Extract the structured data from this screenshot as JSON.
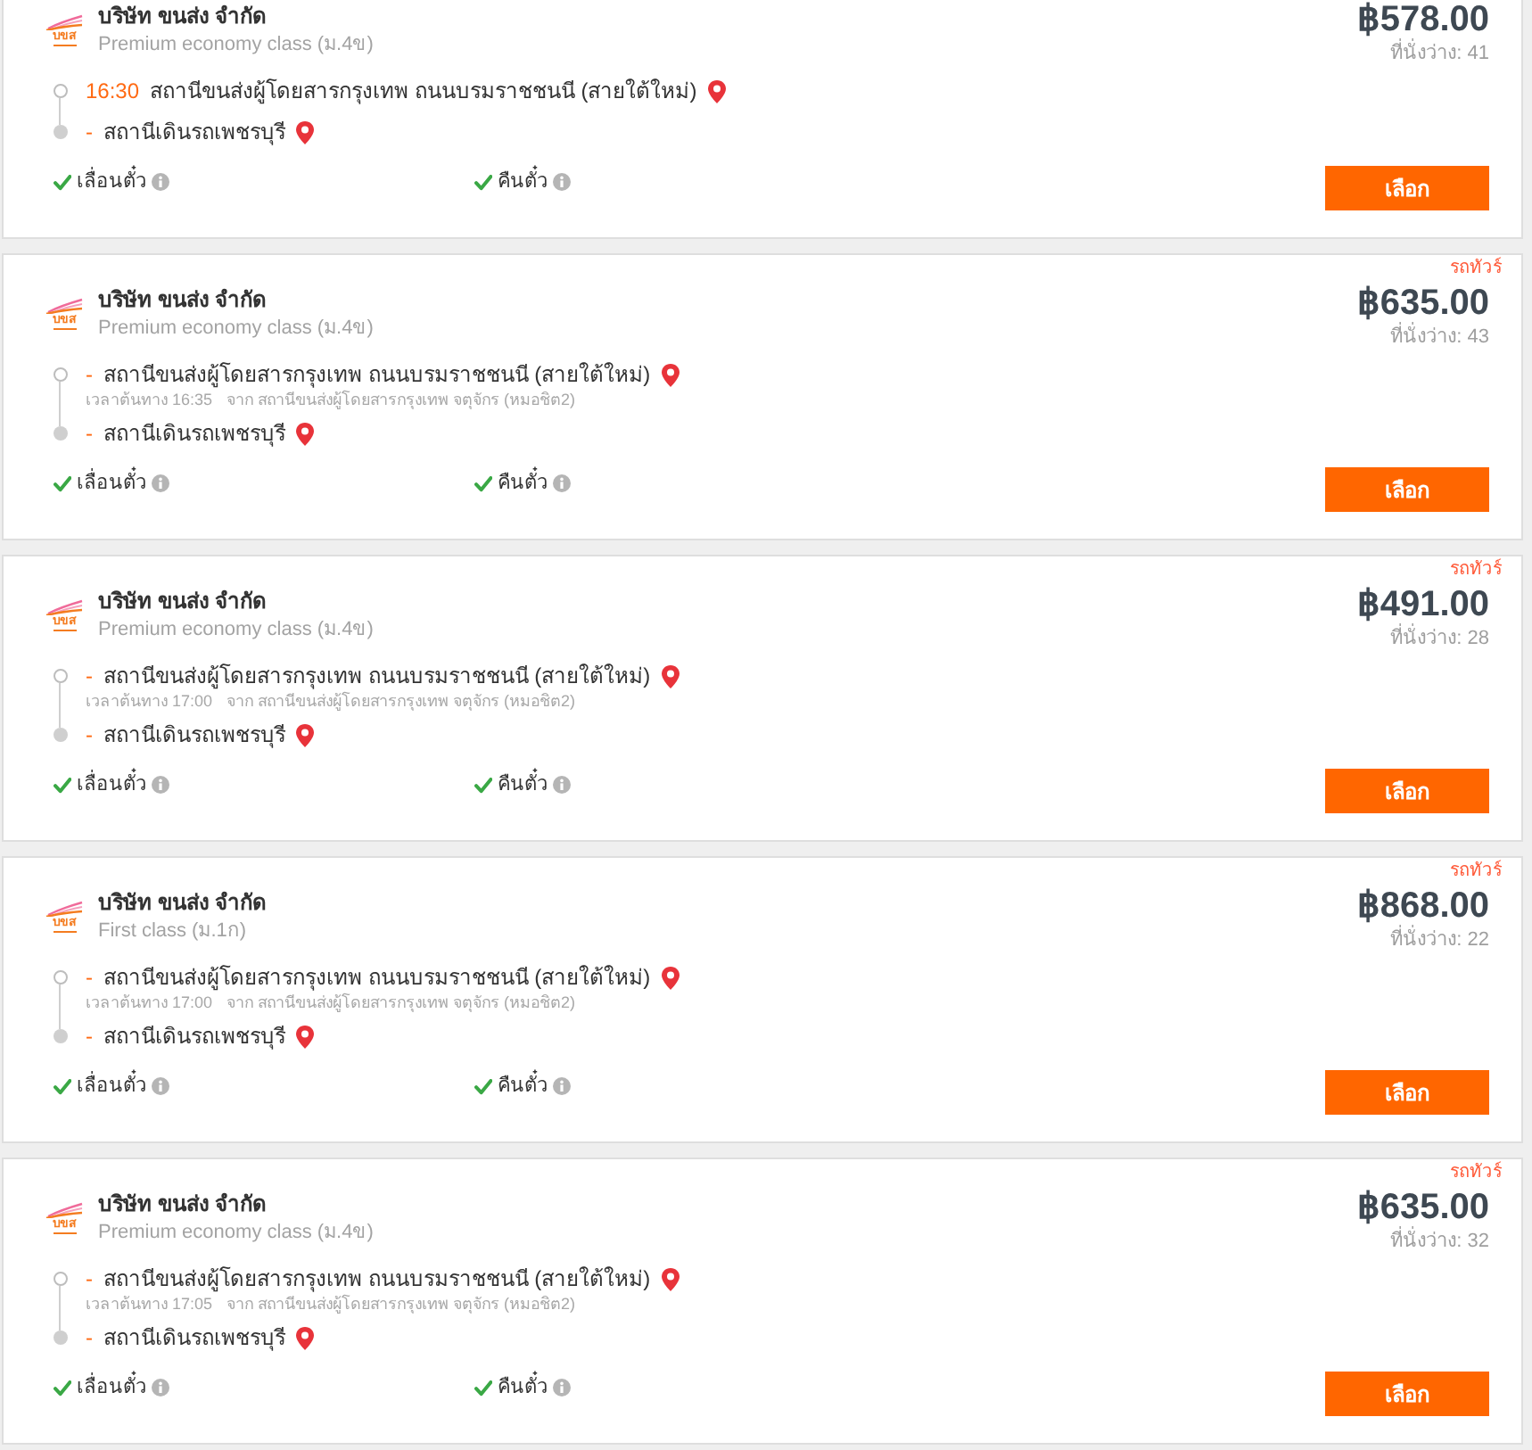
{
  "trips": [
    {
      "operator": "บริษัท ขนส่ง จำกัด",
      "logo_text": "บขส",
      "class": "Premium economy class (ม.4ข)",
      "price": "฿578.00",
      "seats": "ที่นั่งว่าง: 41",
      "departure": {
        "time": "16:30",
        "station": "สถานีขนส่งผู้โดยสารกรุงเทพ ถนนบรมราชชนนี (สายใต้ใหม่)"
      },
      "arrival": {
        "time": "-",
        "station": "สถานีเดินรถเพชรบุรี"
      },
      "policies": [
        {
          "label": "เลื่อนตั๋ว",
          "allowed": true
        },
        {
          "label": "คืนตั๋ว",
          "allowed": true
        }
      ],
      "button": "เลือก"
    },
    {
      "tag": "รถทัวร์",
      "operator": "บริษัท ขนส่ง จำกัด",
      "logo_text": "บขส",
      "class": "Premium economy class (ม.4ข)",
      "price": "฿635.00",
      "seats": "ที่นั่งว่าง: 43",
      "departure": {
        "time": "-",
        "station": "สถานีขนส่งผู้โดยสารกรุงเทพ ถนนบรมราชชนนี (สายใต้ใหม่)",
        "note": {
          "origin_time": "เวลาต้นทาง 16:35",
          "origin_station": "จาก สถานีขนส่งผู้โดยสารกรุงเทพ จตุจักร (หมอชิต2)"
        }
      },
      "arrival": {
        "time": "-",
        "station": "สถานีเดินรถเพชรบุรี"
      },
      "policies": [
        {
          "label": "เลื่อนตั๋ว",
          "allowed": true
        },
        {
          "label": "คืนตั๋ว",
          "allowed": true
        }
      ],
      "button": "เลือก"
    },
    {
      "tag": "รถทัวร์",
      "operator": "บริษัท ขนส่ง จำกัด",
      "logo_text": "บขส",
      "class": "Premium economy class (ม.4ข)",
      "price": "฿491.00",
      "seats": "ที่นั่งว่าง: 28",
      "departure": {
        "time": "-",
        "station": "สถานีขนส่งผู้โดยสารกรุงเทพ ถนนบรมราชชนนี (สายใต้ใหม่)",
        "note": {
          "origin_time": "เวลาต้นทาง 17:00",
          "origin_station": "จาก สถานีขนส่งผู้โดยสารกรุงเทพ จตุจักร (หมอชิต2)"
        }
      },
      "arrival": {
        "time": "-",
        "station": "สถานีเดินรถเพชรบุรี"
      },
      "policies": [
        {
          "label": "เลื่อนตั๋ว",
          "allowed": true
        },
        {
          "label": "คืนตั๋ว",
          "allowed": true
        }
      ],
      "button": "เลือก"
    },
    {
      "tag": "รถทัวร์",
      "operator": "บริษัท ขนส่ง จำกัด",
      "logo_text": "บขส",
      "class": "First class (ม.1ก)",
      "price": "฿868.00",
      "seats": "ที่นั่งว่าง: 22",
      "departure": {
        "time": "-",
        "station": "สถานีขนส่งผู้โดยสารกรุงเทพ ถนนบรมราชชนนี (สายใต้ใหม่)",
        "note": {
          "origin_time": "เวลาต้นทาง 17:00",
          "origin_station": "จาก สถานีขนส่งผู้โดยสารกรุงเทพ จตุจักร (หมอชิต2)"
        }
      },
      "arrival": {
        "time": "-",
        "station": "สถานีเดินรถเพชรบุรี"
      },
      "policies": [
        {
          "label": "เลื่อนตั๋ว",
          "allowed": true
        },
        {
          "label": "คืนตั๋ว",
          "allowed": true
        }
      ],
      "button": "เลือก"
    },
    {
      "tag": "รถทัวร์",
      "operator": "บริษัท ขนส่ง จำกัด",
      "logo_text": "บขส",
      "class": "Premium economy class (ม.4ข)",
      "price": "฿635.00",
      "seats": "ที่นั่งว่าง: 32",
      "departure": {
        "time": "-",
        "station": "สถานีขนส่งผู้โดยสารกรุงเทพ ถนนบรมราชชนนี (สายใต้ใหม่)",
        "note": {
          "origin_time": "เวลาต้นทาง 17:05",
          "origin_station": "จาก สถานีขนส่งผู้โดยสารกรุงเทพ จตุจักร (หมอชิต2)"
        }
      },
      "arrival": {
        "time": "-",
        "station": "สถานีเดินรถเพชรบุรี"
      },
      "policies": [
        {
          "label": "เลื่อนตั๋ว",
          "allowed": true
        },
        {
          "label": "คืนตั๋ว",
          "allowed": true
        }
      ],
      "button": "เลือก"
    }
  ]
}
